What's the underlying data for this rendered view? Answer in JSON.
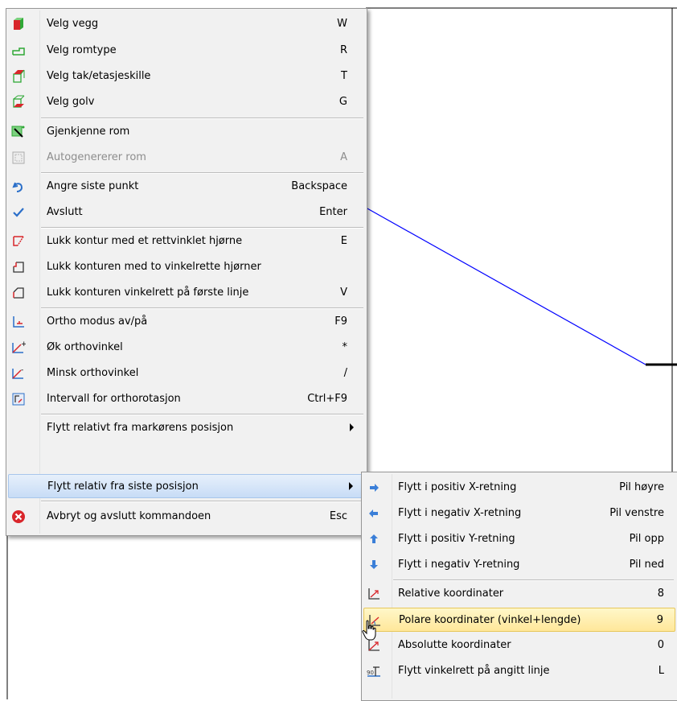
{
  "main_menu": {
    "items": [
      {
        "label": "Velg vegg",
        "key": "W"
      },
      {
        "label": "Velg romtype",
        "key": "R"
      },
      {
        "label": "Velg tak/etasjeskille",
        "key": "T"
      },
      {
        "label": "Velg golv",
        "key": "G"
      },
      {
        "label": "Gjenkjenne rom",
        "key": ""
      },
      {
        "label": "Autogenererer rom",
        "key": "A",
        "disabled": true
      },
      {
        "label": "Angre siste punkt",
        "key": "Backspace"
      },
      {
        "label": "Avslutt",
        "key": "Enter"
      },
      {
        "label": "Lukk kontur med et rettvinklet hjørne",
        "key": "E"
      },
      {
        "label": "Lukk konturen med to vinkelrette hjørner",
        "key": ""
      },
      {
        "label": "Lukk konturen vinkelrett på første linje",
        "key": "V"
      },
      {
        "label": "Ortho modus av/på",
        "key": "F9"
      },
      {
        "label": "Øk orthovinkel",
        "key": "*"
      },
      {
        "label": "Minsk orthovinkel",
        "key": "/"
      },
      {
        "label": "Intervall for orthorotasjon",
        "key": "Ctrl+F9"
      },
      {
        "label": "Flytt relativt fra markørens posisjon",
        "key": "",
        "submenu": true
      },
      {
        "label": "Flytt relativ fra siste posisjon",
        "key": "",
        "submenu": true,
        "highlighted": true
      },
      {
        "label": "Avbryt og avslutt kommandoen",
        "key": "Esc"
      }
    ]
  },
  "sub_menu": {
    "items": [
      {
        "label": "Flytt i positiv X-retning",
        "key": "Pil høyre"
      },
      {
        "label": "Flytt i negativ X-retning",
        "key": "Pil venstre"
      },
      {
        "label": "Flytt i positiv Y-retning",
        "key": "Pil opp"
      },
      {
        "label": "Flytt i negativ Y-retning",
        "key": "Pil ned"
      },
      {
        "label": "Relative koordinater",
        "key": "8"
      },
      {
        "label": "Polare koordinater (vinkel+lengde)",
        "key": "9",
        "highlighted": true
      },
      {
        "label": "Absolutte koordinater",
        "key": "0"
      },
      {
        "label": "Flytt vinkelrett på angitt linje",
        "key": "L"
      }
    ]
  },
  "colors": {
    "canvas_line": "#0000ff",
    "menu_background": "#f1f1f1",
    "highlight_blue": "#c7dcf6",
    "highlight_yellow": "#ffe79a",
    "cancel_red": "#d9262b"
  }
}
